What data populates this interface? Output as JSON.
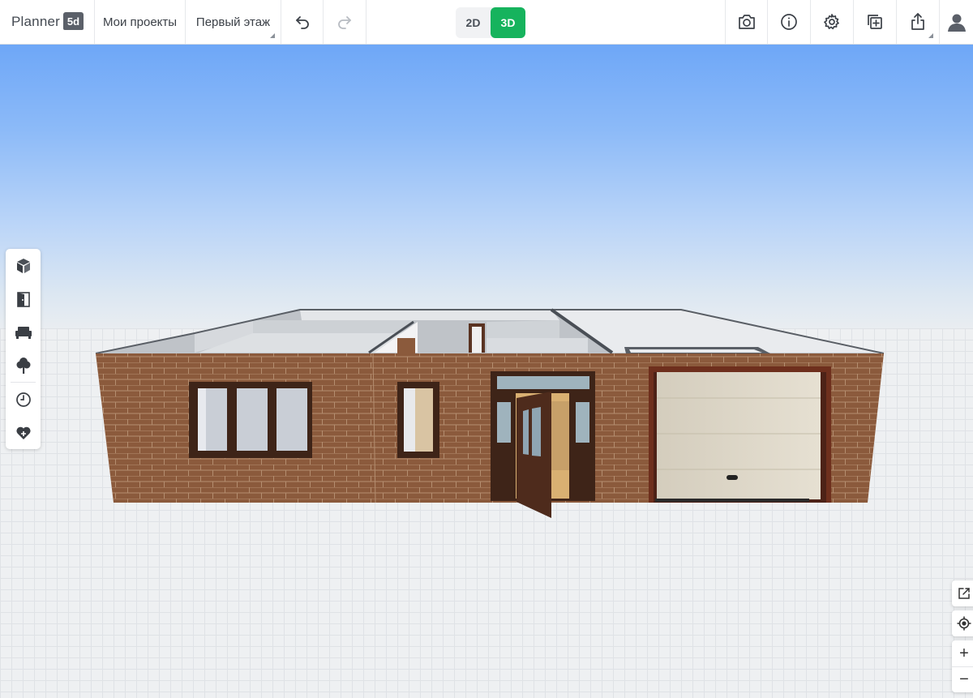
{
  "app": {
    "logo_text": "Planner",
    "logo_badge": "5d"
  },
  "toolbar": {
    "projects_label": "Мои проекты",
    "floor_label": "Первый этаж",
    "view_2d_label": "2D",
    "view_3d_label": "3D",
    "active_view": "3D"
  },
  "zoom": {
    "in_label": "+",
    "out_label": "−"
  },
  "colors": {
    "accent": "#16b35d",
    "brick": "#8b5a3c",
    "sky_top": "#6ea7f7"
  },
  "icons": {
    "left_panel": [
      "cube-icon",
      "door-icon",
      "sofa-icon",
      "tree-icon",
      "history-icon",
      "favorite-icon"
    ],
    "toolbar_right": [
      "camera-icon",
      "info-icon",
      "gear-icon",
      "copy-add-icon",
      "share-icon",
      "user-icon"
    ]
  }
}
